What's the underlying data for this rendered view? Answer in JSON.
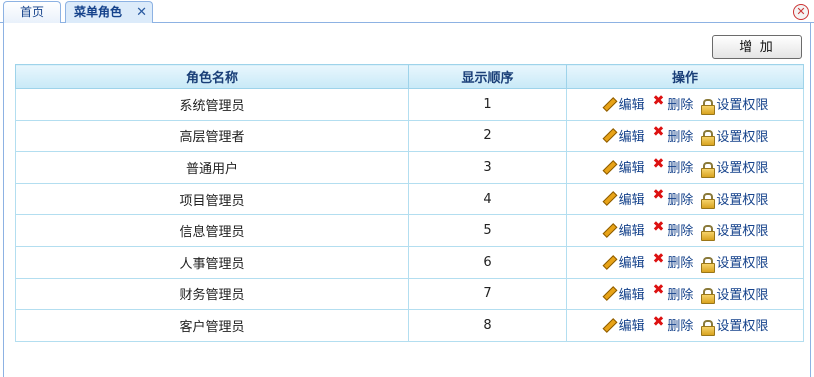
{
  "tabs": {
    "home": "首页",
    "active": "菜单角色",
    "active_close": "✕",
    "panel_close": "✕"
  },
  "toolbar": {
    "add_label": "增 加"
  },
  "table": {
    "headers": [
      "角色名称",
      "显示顺序",
      "操作"
    ],
    "actions": {
      "edit": "编辑",
      "delete": "删除",
      "permissions": "设置权限"
    },
    "rows": [
      {
        "name": "系统管理员",
        "order": "1"
      },
      {
        "name": "高层管理者",
        "order": "2"
      },
      {
        "name": "普通用户",
        "order": "3"
      },
      {
        "name": "项目管理员",
        "order": "4"
      },
      {
        "name": "信息管理员",
        "order": "5"
      },
      {
        "name": "人事管理员",
        "order": "6"
      },
      {
        "name": "财务管理员",
        "order": "7"
      },
      {
        "name": "客户管理员",
        "order": "8"
      }
    ]
  }
}
